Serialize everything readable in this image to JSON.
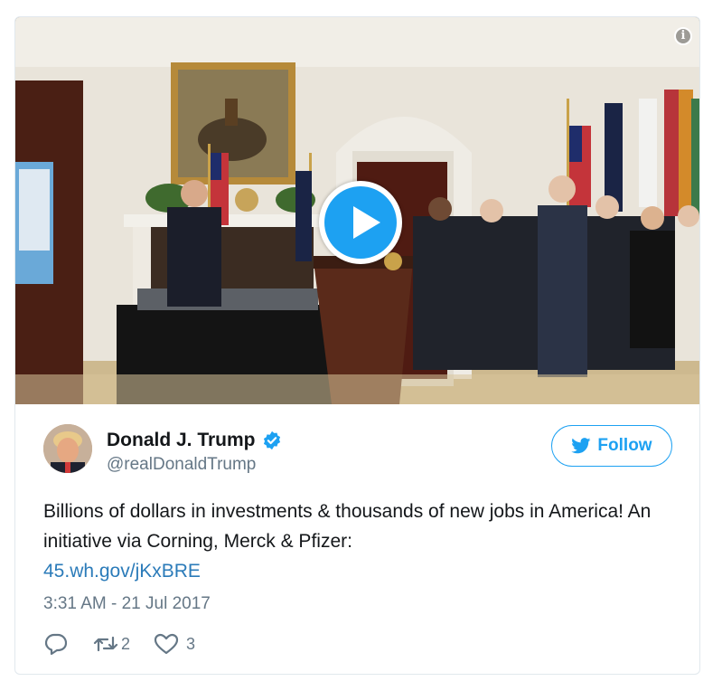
{
  "media": {
    "info_icon": "info-icon",
    "play_icon": "play-icon"
  },
  "tweet": {
    "author_name": "Donald J. Trump",
    "author_handle": "@realDonaldTrump",
    "verified_icon": "verified-badge-icon",
    "follow_label": "Follow",
    "text": "Billions of dollars in investments & thousands of new jobs in America! An initiative via Corning, Merck & Pfizer:",
    "link_text": "45.wh.gov/jKxBRE",
    "timestamp": "3:31 AM - 21 Jul 2017",
    "reply_count": "",
    "retweet_count": "2",
    "like_count": "3"
  },
  "colors": {
    "accent": "#1da1f2",
    "link": "#2b7bb9",
    "muted": "#657786"
  }
}
